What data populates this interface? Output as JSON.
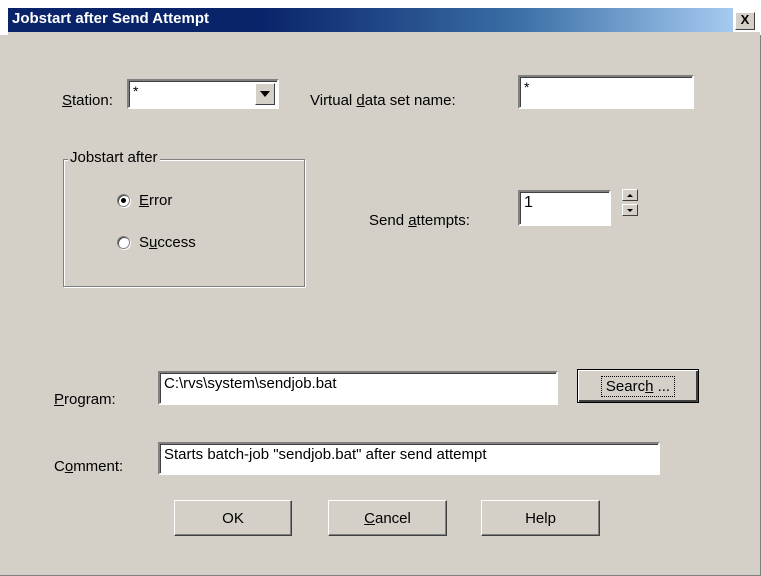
{
  "window": {
    "title": "Jobstart after Send Attempt",
    "close_label": "X"
  },
  "station": {
    "label_pre": "",
    "label_ul": "S",
    "label_post": "tation:",
    "value": "*"
  },
  "vdsn": {
    "label_pre": "Virtual ",
    "label_ul": "d",
    "label_post": "ata set name:",
    "value": "*"
  },
  "jobstart": {
    "legend": "Jobstart after",
    "error": {
      "label_pre": "",
      "label_ul": "E",
      "label_post": "rror",
      "selected": true
    },
    "success": {
      "label_pre": "S",
      "label_ul": "u",
      "label_post": "ccess",
      "selected": false
    }
  },
  "attempts": {
    "label_pre": "Send ",
    "label_ul": "a",
    "label_post": "ttempts:",
    "value": "1"
  },
  "program": {
    "label_pre": "",
    "label_ul": "P",
    "label_post": "rogram:",
    "value": "C:\\rvs\\system\\sendjob.bat"
  },
  "search": {
    "label_pre": "Searc",
    "label_ul": "h",
    "label_post": " ..."
  },
  "comment": {
    "label_pre": "C",
    "label_ul": "o",
    "label_post": "mment:",
    "value": "Starts batch-job \"sendjob.bat\" after send attempt"
  },
  "buttons": {
    "ok": "OK",
    "cancel_pre": "",
    "cancel_ul": "C",
    "cancel_post": "ancel",
    "help": "Help"
  }
}
